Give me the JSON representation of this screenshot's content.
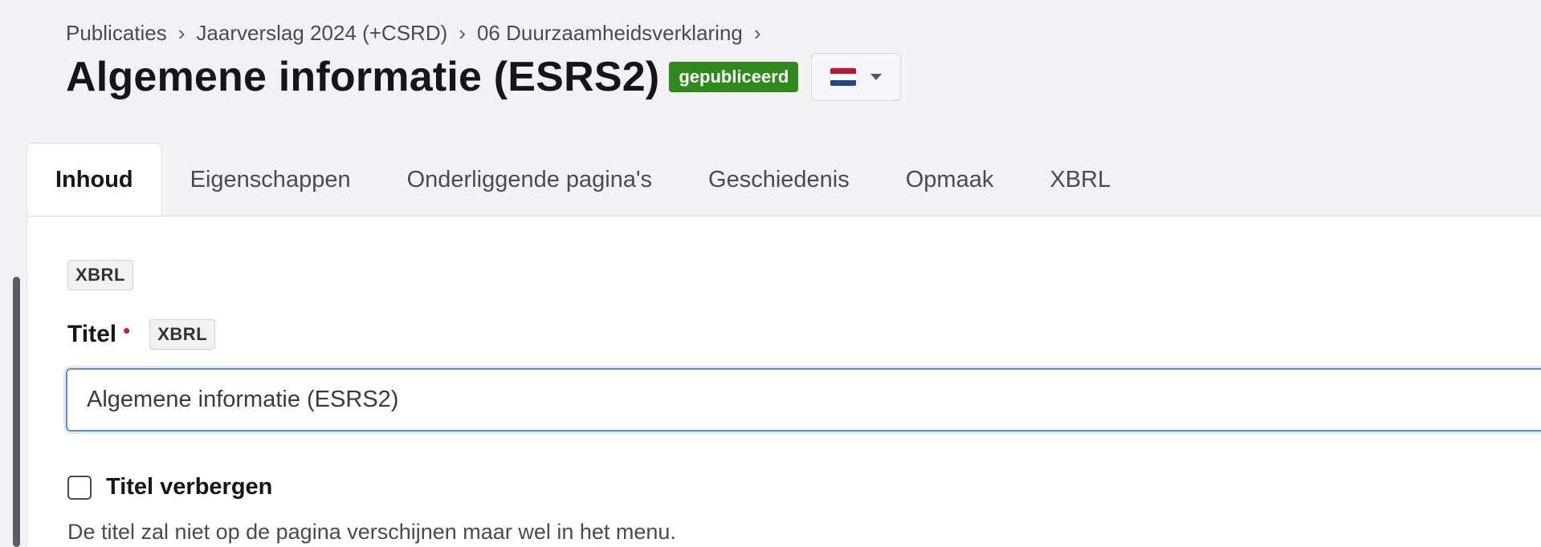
{
  "breadcrumb": [
    "Publicaties",
    "Jaarverslag 2024 (+CSRD)",
    "06 Duurzaamheidsverklaring"
  ],
  "breadcrumb_separator": "›",
  "page": {
    "title": "Algemene informatie (ESRS2)",
    "status": "gepubliceerd",
    "status_color": "#2f8a1c",
    "language_flag": "flag-nl-icon"
  },
  "tabs": [
    "Inhoud",
    "Eigenschappen",
    "Onderliggende pagina's",
    "Geschiedenis",
    "Opmaak",
    "XBRL"
  ],
  "active_tab": "Inhoud",
  "content": {
    "xbrl_tag": "XBRL",
    "title_field": {
      "label": "Titel",
      "required_marker": "•",
      "xbrl_tag": "XBRL",
      "value": "Algemene informatie (ESRS2)"
    },
    "hide_title": {
      "label": "Titel verbergen",
      "checked": false,
      "help": "De titel zal niet op de pagina verschijnen maar wel in het menu."
    }
  },
  "colors": {
    "accent": "#5b8fd6",
    "required": "#d11a1a"
  }
}
